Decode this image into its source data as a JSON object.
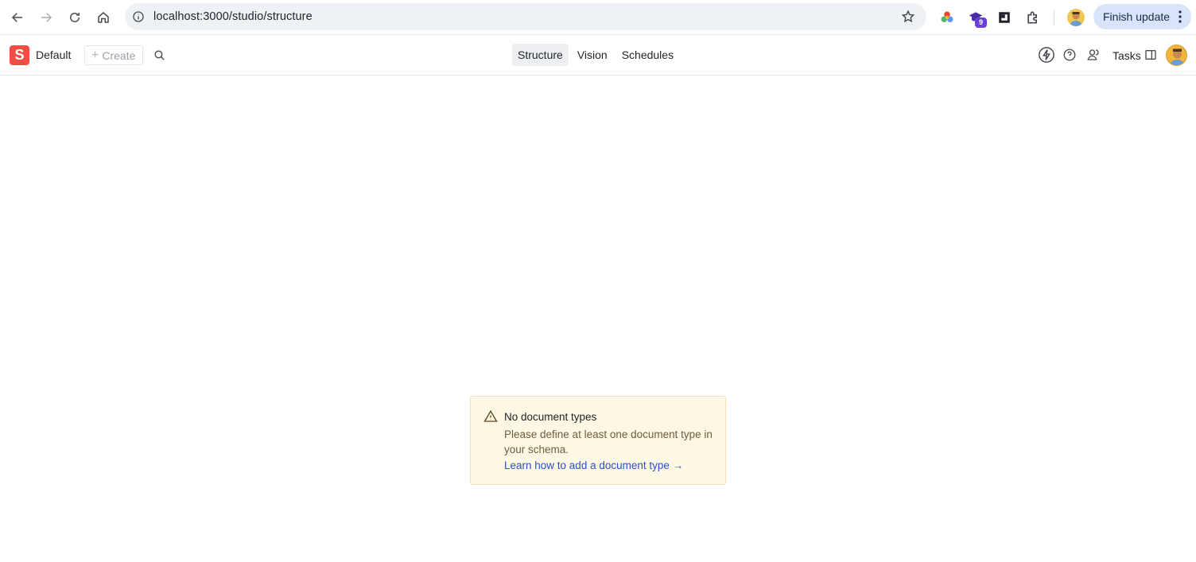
{
  "browser": {
    "url": "localhost:3000/studio/structure",
    "extension_badge": "9",
    "finish_update_label": "Finish update"
  },
  "studio": {
    "logo_letter": "S",
    "workspace_name": "Default",
    "create_label": "Create",
    "tools": [
      {
        "label": "Structure",
        "active": true
      },
      {
        "label": "Vision",
        "active": false
      },
      {
        "label": "Schedules",
        "active": false
      }
    ],
    "tasks_label": "Tasks"
  },
  "notice": {
    "title": "No document types",
    "description": "Please define at least one document type in your schema.",
    "link_label": "Learn how to add a document type →"
  },
  "colors": {
    "accent": "#f04e45",
    "notice_bg": "#fdf8e3",
    "link": "#2b50c8"
  }
}
